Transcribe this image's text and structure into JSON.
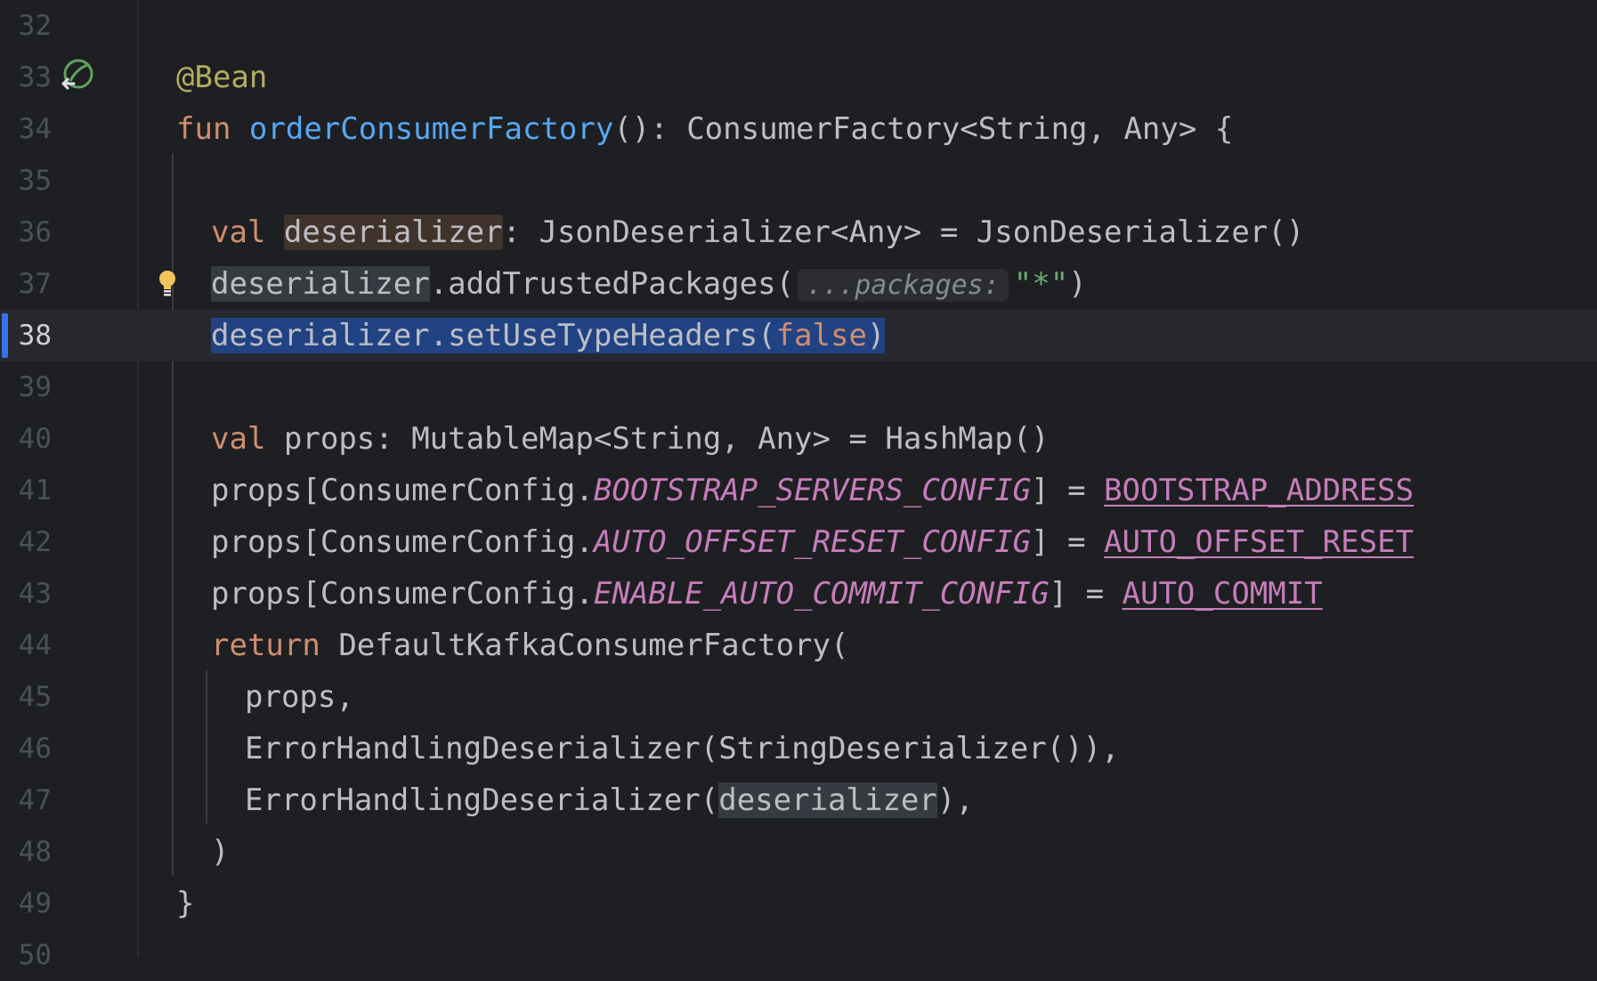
{
  "editor": {
    "current_line": 38,
    "lines": [
      {
        "n": "32"
      },
      {
        "n": "33",
        "t1": "@Bean"
      },
      {
        "n": "34",
        "t1": "fun",
        "t2": "orderConsumerFactory",
        "t3": "(): ConsumerFactory<String, Any> {"
      },
      {
        "n": "35"
      },
      {
        "n": "36",
        "t1": "val",
        "t2": "deserializer",
        "t3": ": JsonDeserializer<Any> = JsonDeserializer()"
      },
      {
        "n": "37",
        "t1": "deserializer",
        "t2": ".addTrustedPackages(",
        "hint": "...packages:",
        "str": "\"*\"",
        "t3": ")"
      },
      {
        "n": "38",
        "t1": "deserializer.setUseTypeHeaders(",
        "kw": "false",
        "t2": ")"
      },
      {
        "n": "39"
      },
      {
        "n": "40",
        "t1": "val",
        "t2": "props: MutableMap<String, Any> = HashMap()"
      },
      {
        "n": "41",
        "t1": "props[ConsumerConfig.",
        "const": "BOOTSTRAP_SERVERS_CONFIG",
        "t2": "] = ",
        "prop": "BOOTSTRAP_ADDRESS"
      },
      {
        "n": "42",
        "t1": "props[ConsumerConfig.",
        "const": "AUTO_OFFSET_RESET_CONFIG",
        "t2": "] = ",
        "prop": "AUTO_OFFSET_RESET"
      },
      {
        "n": "43",
        "t1": "props[ConsumerConfig.",
        "const": "ENABLE_AUTO_COMMIT_CONFIG",
        "t2": "] = ",
        "prop": "AUTO_COMMIT"
      },
      {
        "n": "44",
        "t1": "return",
        "t2": "DefaultKafkaConsumerFactory("
      },
      {
        "n": "45",
        "t1": "props,"
      },
      {
        "n": "46",
        "t1": "ErrorHandlingDeserializer(StringDeserializer()),"
      },
      {
        "n": "47",
        "t1": "ErrorHandlingDeserializer(",
        "t2": "deserializer",
        "t3": "),"
      },
      {
        "n": "48",
        "t1": ")"
      },
      {
        "n": "49",
        "t1": "}"
      },
      {
        "n": "50"
      }
    ]
  },
  "icons": {
    "bean_gutter": "spring-bean-navigate-icon",
    "intention": "lightbulb-icon"
  },
  "colors": {
    "background": "#1e1f22",
    "keyword": "#cf8e6d",
    "function": "#56a8f5",
    "annotation": "#b3ae60",
    "constant": "#c77dbb",
    "string": "#6aab73",
    "selection": "#214283"
  }
}
